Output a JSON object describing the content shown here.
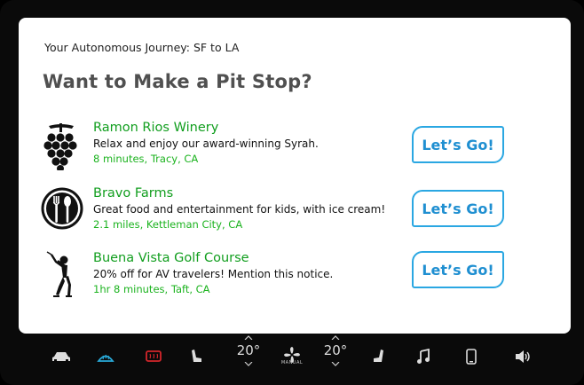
{
  "screen": {
    "journey": "Your Autonomous Journey: SF to LA",
    "headline": "Want to Make a Pit Stop?"
  },
  "stops": [
    {
      "icon": "grapes-icon",
      "name": "Ramon Rios Winery",
      "description": "Relax and enjoy our award-winning Syrah.",
      "meta": "8 minutes, Tracy, CA",
      "button": "Let’s Go!"
    },
    {
      "icon": "plate-fork-spoon-icon",
      "name": "Bravo Farms",
      "description": "Great food and entertainment for kids, with ice cream!",
      "meta": "2.1 miles, Kettleman City, CA",
      "button": "Let’s Go!"
    },
    {
      "icon": "golfer-icon",
      "name": "Buena Vista Golf Course",
      "description": "20% off for AV travelers! Mention this notice.",
      "meta": "1hr 8 minutes, Taft, CA",
      "button": "Let’s Go!"
    }
  ],
  "bar": {
    "driver_temp": "20°",
    "passenger_temp": "20°",
    "fan_label": "MANUAL",
    "icons": [
      "car-icon",
      "front-defrost-icon",
      "rear-defrost-icon",
      "driver-seat-heat-icon",
      "fan-icon",
      "passenger-seat-heat-icon",
      "music-note-icon",
      "phone-icon",
      "volume-icon"
    ]
  },
  "colors": {
    "stop_name": "#119e1e",
    "stop_meta": "#1cb31f",
    "button_border": "#2aa7e2",
    "button_text": "#1f8fd1",
    "front_defrost": "#29a9d8",
    "rear_defrost": "#d4262b"
  }
}
